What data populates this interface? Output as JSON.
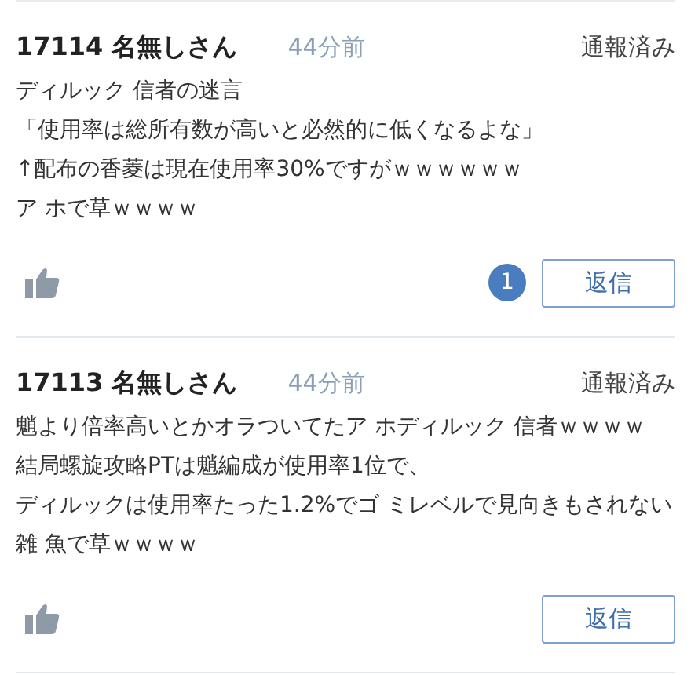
{
  "posts": [
    {
      "number": "17114",
      "name": "名無しさん",
      "time": "44分前",
      "status": "通報済み",
      "lines": [
        "ディルック 信者の迷言",
        "「使用率は総所有数が高いと必然的に低くなるよな」",
        "↑配布の香菱は現在使用率30%ですがｗｗｗｗｗｗ",
        "ア ホで草ｗｗｗｗ"
      ],
      "reply_count": "1",
      "reply_label": "返信"
    },
    {
      "number": "17113",
      "name": "名無しさん",
      "time": "44分前",
      "status": "通報済み",
      "lines": [
        "魈より倍率高いとかオラついてたア ホディルック 信者ｗｗｗｗ",
        "結局螺旋攻略PTは魈編成が使用率1位で、",
        "ディルックは使用率たった1.2%でゴ ミレベルで見向きもされない",
        "雑 魚で草ｗｗｗｗ"
      ],
      "reply_label": "返信"
    }
  ]
}
